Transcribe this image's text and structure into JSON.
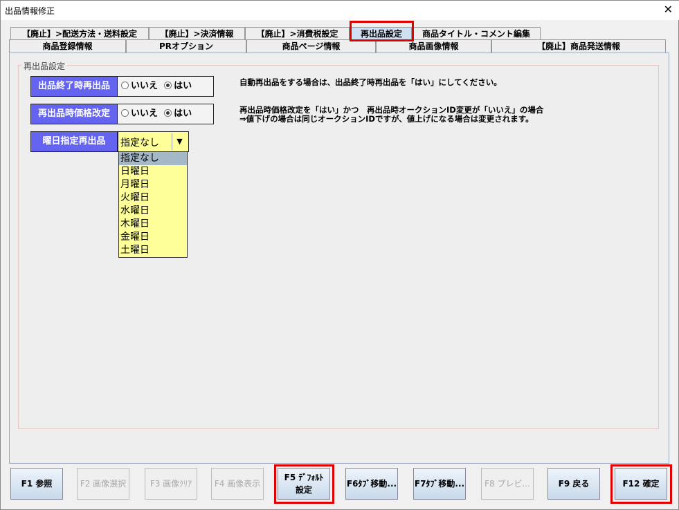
{
  "window": {
    "title": "出品情報修正",
    "close": "✕"
  },
  "tabs_row1": [
    "【廃止】>配送方法・送料設定",
    "【廃止】>決済情報",
    "【廃止】>消費税設定",
    "再出品設定",
    "商品タイトル・コメント編集"
  ],
  "tabs_row2": [
    "商品登録情報",
    "PRオプション",
    "商品ページ情報",
    "商品画像情報",
    "【廃止】商品発送情報"
  ],
  "group_title": "再出品設定",
  "fields": [
    {
      "label": "出品終了時再出品",
      "options": [
        "いいえ",
        "はい"
      ],
      "selected": "はい"
    },
    {
      "label": "再出品時価格改定",
      "options": [
        "いいえ",
        "はい"
      ],
      "selected": "はい"
    },
    {
      "label": "曜日指定再出品",
      "value": "指定なし"
    }
  ],
  "notes": [
    "自動再出品をする場合は、出品終了時再出品を「はい」にしてください。",
    "再出品時価格改定を「はい」かつ　再出品時オークションID変更が「いいえ」の場合",
    "⇒値下げの場合は同じオークションIDですが、値上げになる場合は変更されます。"
  ],
  "dropdown_options": [
    "指定なし",
    "日曜日",
    "月曜日",
    "火曜日",
    "水曜日",
    "木曜日",
    "金曜日",
    "土曜日"
  ],
  "buttons": [
    {
      "label": "F1 参照",
      "enabled": true
    },
    {
      "label": "F2 画像選択",
      "enabled": false
    },
    {
      "label": "F3 画像ｸﾘｱ",
      "enabled": false
    },
    {
      "label": "F4 画像表示",
      "enabled": false
    },
    {
      "label": "F5 ﾃﾞﾌｫﾙﾄ\n設定",
      "enabled": true
    },
    {
      "label": "F6ﾀﾌﾞ移動...",
      "enabled": true
    },
    {
      "label": "F7ﾀﾌﾞ移動...",
      "enabled": true
    },
    {
      "label": "F8 プレビ...",
      "enabled": false
    },
    {
      "label": "F9 戻る",
      "enabled": true
    },
    {
      "label": "F12 確定",
      "enabled": true
    }
  ]
}
